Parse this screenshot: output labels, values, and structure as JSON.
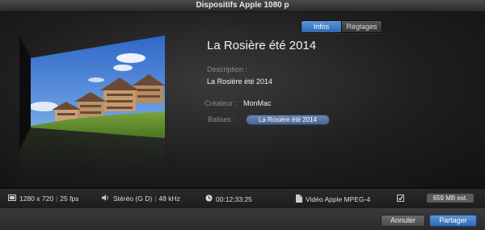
{
  "window": {
    "title": "Dispositifs Apple 1080 p"
  },
  "tabs": [
    {
      "label": "Infos",
      "active": true
    },
    {
      "label": "Réglages",
      "active": false
    }
  ],
  "info": {
    "title": "La Rosière été 2014",
    "description_label": "Description :",
    "description_value": "La Rosière été 2014",
    "creator_label": "Créateur :",
    "creator_value": "MonMac",
    "tags_label": "Balises :",
    "tag_value": "La Rosière été 2014"
  },
  "status": {
    "resolution": "1280 x 720",
    "fps": "25 fps",
    "audio": "Stéréo (G D)",
    "sample_rate": "48 kHz",
    "duration": "00:12:33:25",
    "format": "Vidéo Apple MPEG-4",
    "size": "659 MB est."
  },
  "buttons": {
    "cancel": "Annuler",
    "share": "Partager"
  },
  "colors": {
    "accent": "#3a78c6",
    "tag": "#5a76a2"
  },
  "icons": {
    "resolution": "film-frame-icon",
    "audio": "speaker-icon",
    "duration": "clock-icon",
    "format": "document-icon",
    "compat": "checkbox-icon"
  }
}
